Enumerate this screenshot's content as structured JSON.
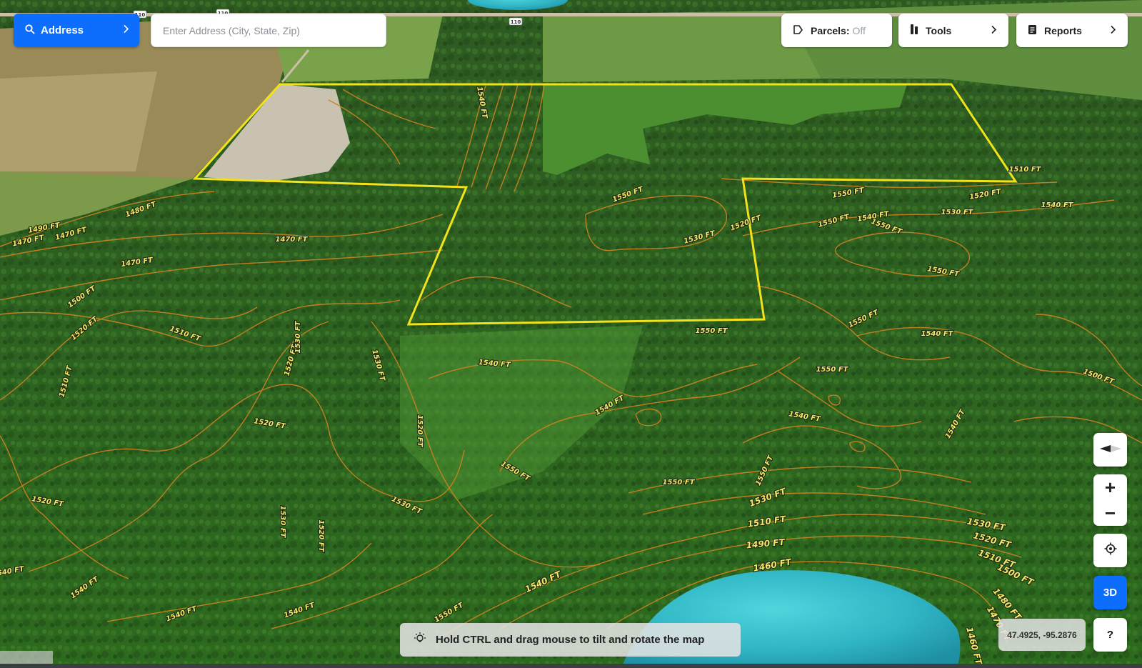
{
  "search": {
    "mode_label": "Address",
    "placeholder": "Enter Address (City, State, Zip)",
    "value": ""
  },
  "toolbar": {
    "parcels_label": "Parcels:",
    "parcels_state": "Off",
    "tools_label": "Tools",
    "reports_label": "Reports"
  },
  "controls": {
    "zoom_in": "+",
    "zoom_out": "−",
    "view_mode": "3D",
    "help": "?"
  },
  "coordinates": "47.4925, -95.2876",
  "hint": "Hold CTRL and drag mouse to tilt and rotate the map",
  "roads": [
    "110",
    "110",
    "110"
  ],
  "contour_labels": [
    "1480 FT",
    "1470 FT",
    "1470 FT",
    "1490 FT",
    "1470 FT",
    "1470 FT",
    "1500 FT",
    "1510 FT",
    "1520 FT",
    "1510 FT",
    "1520 FT",
    "1520 FT",
    "1520 FT",
    "1530 FT",
    "1530 FT",
    "1520 FT",
    "1530 FT",
    "1540 FT",
    "1540 FT",
    "1540 FT",
    "1550 FT",
    "1540 FT",
    "1550 FT",
    "1550 FT",
    "1550 FT",
    "1540 FT",
    "1550 FT",
    "1540 FT",
    "1550 FT",
    "1550 FT",
    "1540 FT",
    "1540 FT",
    "1550 FT",
    "1540 FT",
    "1530 FT",
    "1510 FT",
    "1490 FT",
    "1460 FT",
    "1530 FT",
    "1520 FT",
    "1510 FT",
    "1500 FT",
    "1480 FT",
    "1470 FT",
    "1460 FT",
    "1540 FT",
    "1530 FT",
    "1520 FT",
    "1540 FT",
    "1550 FT",
    "1530 FT",
    "1520 FT",
    "1550 FT",
    "1540 FT",
    "1550 FT",
    "1530 FT",
    "1520 FT",
    "1510 FT",
    "1500 FT",
    "1540 FT",
    "1550 FT"
  ],
  "colors": {
    "accent": "#0d6efd",
    "parcel_boundary": "#f2e21a",
    "contour_line": "#c9821f",
    "water": "#3cc4cf"
  }
}
